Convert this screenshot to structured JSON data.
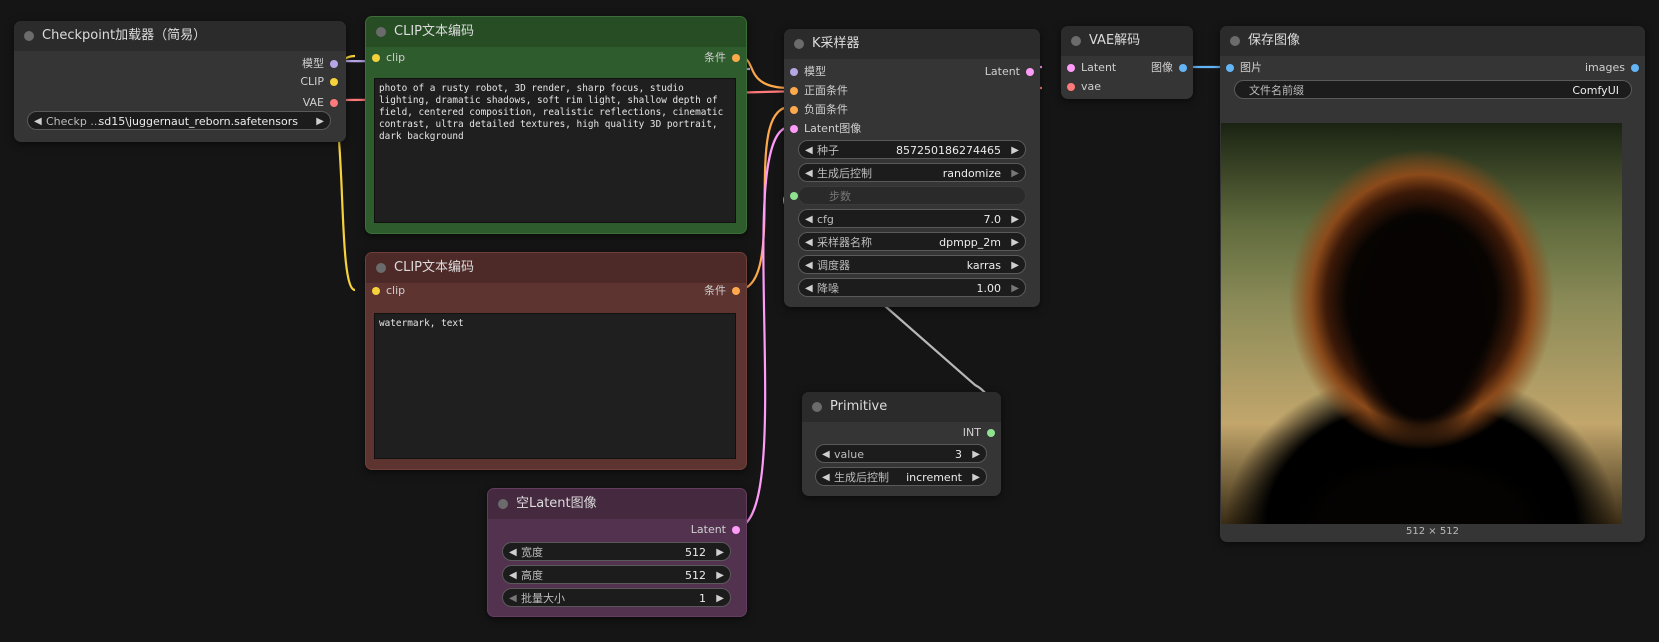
{
  "nodes": {
    "checkpoint": {
      "title": "Checkpoint加载器（简易）",
      "outputs": [
        "模型",
        "CLIP",
        "VAE"
      ],
      "widget": {
        "label": "Checkp ...",
        "value": "sd15\\juggernaut_reborn.safetensors"
      }
    },
    "clip_pos": {
      "title": "CLIP文本编码",
      "input": "clip",
      "output": "条件",
      "text": "photo of a rusty robot, 3D render, sharp focus, studio lighting, dramatic shadows, soft rim light, shallow depth of field, centered composition, realistic reflections, cinematic contrast, ultra detailed textures, high quality 3D portrait, dark background"
    },
    "clip_neg": {
      "title": "CLIP文本编码",
      "input": "clip",
      "output": "条件",
      "text": "watermark, text"
    },
    "ksampler": {
      "title": "K采样器",
      "inputs": [
        "模型",
        "正面条件",
        "负面条件",
        "Latent图像"
      ],
      "output": "Latent",
      "widgets": [
        {
          "label": "种子",
          "value": "857250186274465"
        },
        {
          "label": "生成后控制",
          "value": "randomize"
        },
        {
          "label": "步数",
          "value": ""
        },
        {
          "label": "cfg",
          "value": "7.0"
        },
        {
          "label": "采样器名称",
          "value": "dpmpp_2m"
        },
        {
          "label": "调度器",
          "value": "karras"
        },
        {
          "label": "降噪",
          "value": "1.00"
        }
      ]
    },
    "vae": {
      "title": "VAE解码",
      "inputs": [
        "Latent",
        "vae"
      ],
      "output": "图像"
    },
    "save": {
      "title": "保存图像",
      "input": "图片",
      "output": "images",
      "widget": {
        "label": "文件名前缀",
        "value": "ComfyUI"
      },
      "caption": "512 × 512"
    },
    "primitive": {
      "title": "Primitive",
      "output": "INT",
      "widgets": [
        {
          "label": "value",
          "value": "3"
        },
        {
          "label": "生成后控制",
          "value": "increment"
        }
      ]
    },
    "latent": {
      "title": "空Latent图像",
      "output": "Latent",
      "widgets": [
        {
          "label": "宽度",
          "value": "512"
        },
        {
          "label": "高度",
          "value": "512"
        },
        {
          "label": "批量大小",
          "value": "1"
        }
      ]
    }
  },
  "colors": {
    "model": "#b7a6e6",
    "clip": "#f5d23b",
    "vae": "#ff7a7a",
    "conditioning": "#ffa94d",
    "latent": "#ff9cf9",
    "image": "#64b5f6",
    "int": "#8fe28f",
    "wire_gray": "#b8b8b8"
  }
}
